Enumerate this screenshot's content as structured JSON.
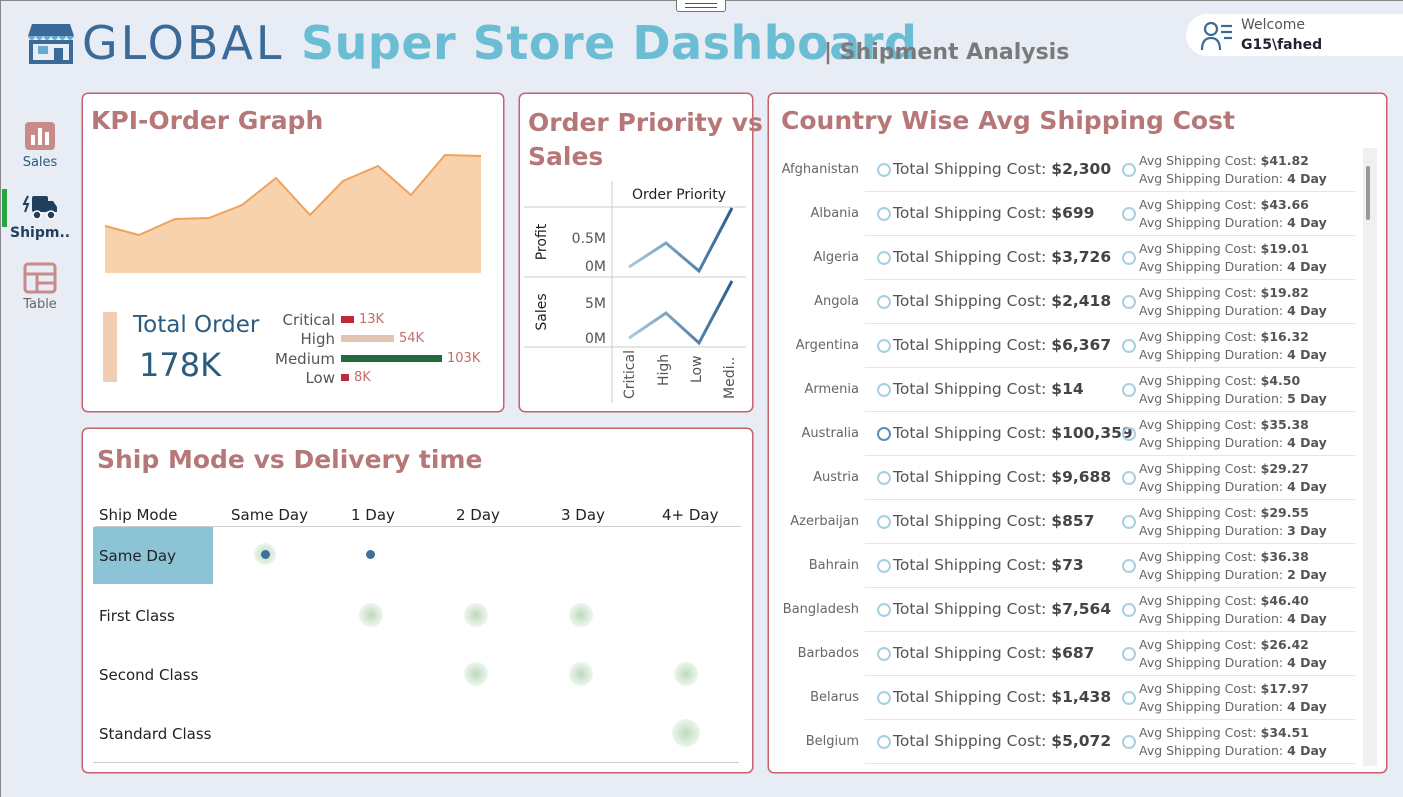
{
  "header": {
    "title_global": "GLOBAL",
    "title_rest": "Super Store Dashboard",
    "subtitle": "| Shipment Analysis",
    "welcome_label": "Welcome",
    "user": "G15\\fahed"
  },
  "nav": {
    "items": [
      {
        "label": "Sales",
        "icon": "bar-chart-icon"
      },
      {
        "label": "Shipm..",
        "icon": "delivery-truck-icon"
      },
      {
        "label": "Table",
        "icon": "table-layout-icon"
      }
    ],
    "active": "Shipm.."
  },
  "kpi": {
    "title": "KPI-Order Graph",
    "total_label": "Total Order",
    "total_value": "178K",
    "priorities": [
      {
        "label": "Critical",
        "value_label": "13K",
        "value": 13,
        "color": "#c0283a"
      },
      {
        "label": "High",
        "value_label": "54K",
        "value": 54,
        "color": "#e2c4b4"
      },
      {
        "label": "Medium",
        "value_label": "103K",
        "value": 103,
        "color": "#27693e"
      },
      {
        "label": "Low",
        "value_label": "8K",
        "value": 8,
        "color": "#c0283a"
      }
    ]
  },
  "order_priority": {
    "title_line1": "Order Priority vs",
    "title_line2": "Sales",
    "column_header": "Order Priority",
    "rows": [
      {
        "label": "Profit",
        "ticks": [
          "0.5M",
          "0M"
        ]
      },
      {
        "label": "Sales",
        "ticks": [
          "5M",
          "0M"
        ]
      }
    ],
    "categories": [
      "Critical",
      "High",
      "Low",
      "Medi.."
    ]
  },
  "ship_mode": {
    "title": "Ship Mode vs Delivery time",
    "row_header": "Ship Mode",
    "columns": [
      "Same Day",
      "1 Day",
      "2 Day",
      "3 Day",
      "4+ Day"
    ],
    "rows": [
      "Same Day",
      "First Class",
      "Second Class",
      "Standard Class"
    ],
    "selected_row": "Same Day"
  },
  "country": {
    "title": "Country Wise Avg Shipping Cost",
    "tsc_label": "Total Shipping Cost:",
    "avg_cost_label": "Avg Shipping Cost:",
    "avg_dur_label": "Avg Shipping Duration:",
    "rows": [
      {
        "name": "Afghanistan",
        "total": "$2,300",
        "avg": "$41.82",
        "dur": "4 Day"
      },
      {
        "name": "Albania",
        "total": "$699",
        "avg": "$43.66",
        "dur": "4 Day"
      },
      {
        "name": "Algeria",
        "total": "$3,726",
        "avg": "$19.01",
        "dur": "4 Day"
      },
      {
        "name": "Angola",
        "total": "$2,418",
        "avg": "$19.82",
        "dur": "4 Day"
      },
      {
        "name": "Argentina",
        "total": "$6,367",
        "avg": "$16.32",
        "dur": "4 Day"
      },
      {
        "name": "Armenia",
        "total": "$14",
        "avg": "$4.50",
        "dur": "5 Day"
      },
      {
        "name": "Australia",
        "total": "$100,359",
        "avg": "$35.38",
        "dur": "4 Day"
      },
      {
        "name": "Austria",
        "total": "$9,688",
        "avg": "$29.27",
        "dur": "4 Day"
      },
      {
        "name": "Azerbaijan",
        "total": "$857",
        "avg": "$29.55",
        "dur": "3 Day"
      },
      {
        "name": "Bahrain",
        "total": "$73",
        "avg": "$36.38",
        "dur": "2 Day"
      },
      {
        "name": "Bangladesh",
        "total": "$7,564",
        "avg": "$46.40",
        "dur": "4 Day"
      },
      {
        "name": "Barbados",
        "total": "$687",
        "avg": "$26.42",
        "dur": "4 Day"
      },
      {
        "name": "Belarus",
        "total": "$1,438",
        "avg": "$17.97",
        "dur": "4 Day"
      },
      {
        "name": "Belgium",
        "total": "$5,072",
        "avg": "$34.51",
        "dur": "4 Day"
      }
    ]
  }
}
